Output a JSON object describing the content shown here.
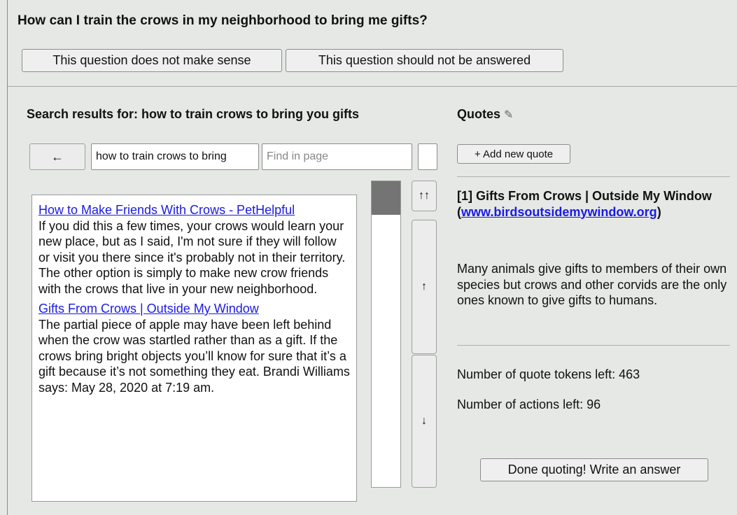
{
  "question": "How can I train the crows in my neighborhood to bring me gifts?",
  "question_buttons": {
    "no_sense": "This question does not make sense",
    "no_answer": "This question should not be answered"
  },
  "search": {
    "title": "Search results for: how to train crows to bring you gifts",
    "back_label": "←",
    "query_value": "how to train crows to bring",
    "find_placeholder": "Find in page"
  },
  "results": [
    {
      "title": "How to Make Friends With Crows - PetHelpful",
      "snippet": "If you did this a few times, your crows would learn your new place, but as I said, I'm not sure if they will follow or visit you there since it's probably not in their territory. The other option is simply to make new crow friends with the crows that live in your new neighborhood."
    },
    {
      "title": "Gifts From Crows | Outside My Window",
      "snippet": "The partial piece of apple may have been left behind when the crow was startled rather than as a gift. If the crows bring bright objects you’ll know for sure that it’s a gift because it’s not something they eat. Brandi Williams says: May 28, 2020 at 7:19 am."
    }
  ],
  "scroll_nav": {
    "top": "↑↑",
    "up": "↑",
    "down": "↓",
    "scroll_position": 0
  },
  "quotes": {
    "title": "Quotes",
    "edit_icon": "✎",
    "add_label": "+ Add new quote",
    "items": [
      {
        "title": "[1] Gifts From Crows | Outside My Window",
        "link_open": "(",
        "link": "www.birdsoutsidemywindow.org",
        "link_close": ")",
        "text": "Many animals give gifts to members of their own species but crows and other corvids are the only ones known to give gifts to humans."
      }
    ],
    "tokens_left": "Number of quote tokens left: 463",
    "actions_left": "Number of actions left: 96",
    "done_label": "Done quoting! Write an answer"
  }
}
